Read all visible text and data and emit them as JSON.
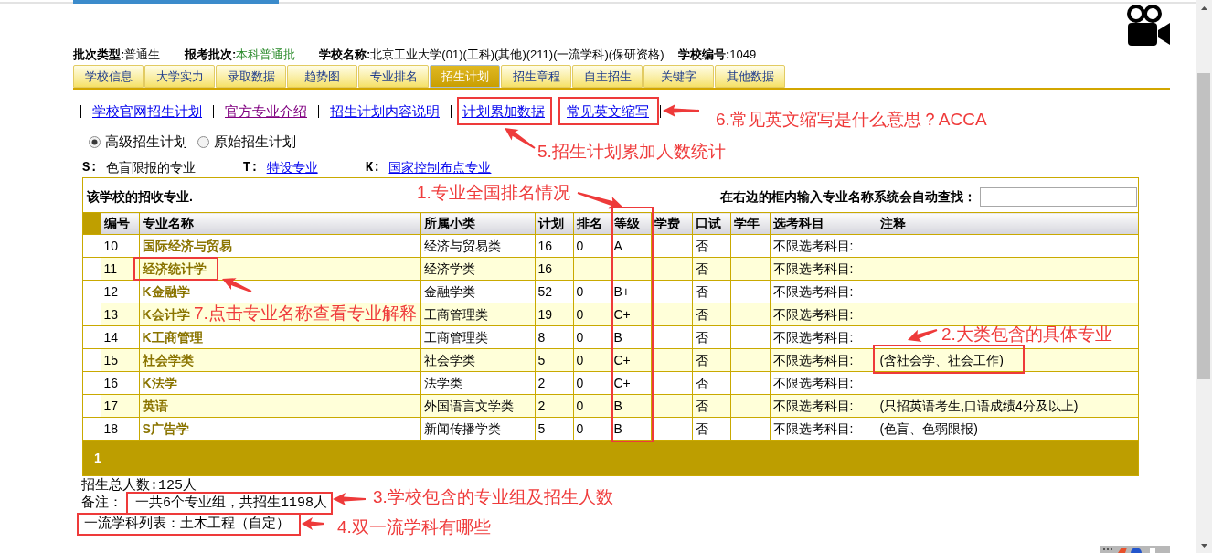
{
  "header_info": [
    {
      "label": "批次类型:",
      "value": "普通生",
      "kind": "plain"
    },
    {
      "label": "报考批次:",
      "value": "本科普通批",
      "kind": "highlight"
    },
    {
      "label": "学校名称:",
      "value": "北京工业大学(01)(工科)(其他)(211)(一流学科)(保研资格)",
      "kind": "plain"
    },
    {
      "label": "学校编号:",
      "value": "1049",
      "kind": "plain"
    }
  ],
  "tabs": [
    {
      "label": "学校信息",
      "selected": false
    },
    {
      "label": "大学实力",
      "selected": false
    },
    {
      "label": "录取数据",
      "selected": false
    },
    {
      "label": "趋势图",
      "selected": false
    },
    {
      "label": "专业排名",
      "selected": false
    },
    {
      "label": "招生计划",
      "selected": true
    },
    {
      "label": "招生章程",
      "selected": false
    },
    {
      "label": "自主招生",
      "selected": false
    },
    {
      "label": "关键字",
      "selected": false
    },
    {
      "label": "其他数据",
      "selected": false
    }
  ],
  "links": [
    {
      "label": "学校官网招生计划",
      "visited": false
    },
    {
      "label": "官方专业介绍",
      "visited": true
    },
    {
      "label": "招生计划内容说明",
      "visited": false
    },
    {
      "label": "计划累加数据",
      "visited": false
    },
    {
      "label": "常见英文缩写",
      "visited": false
    }
  ],
  "plan_options": [
    {
      "label": "高级招生计划",
      "selected": true
    },
    {
      "label": "原始招生计划",
      "selected": false
    }
  ],
  "legend": [
    {
      "key": "S:",
      "text": "色盲限报的专业",
      "kind": "plain"
    },
    {
      "key": "T:",
      "text": "特设专业",
      "kind": "link"
    },
    {
      "key": "K:",
      "text": "国家控制布点专业",
      "kind": "link"
    }
  ],
  "table": {
    "title": "该学校的招收专业.",
    "search_label": "在右边的框内输入专业名称系统会自动查找：",
    "columns": [
      "编号",
      "专业名称",
      "所属小类",
      "计划",
      "排名",
      "等级",
      "学费",
      "口试",
      "学年",
      "选考科目",
      "注释"
    ],
    "rows": [
      {
        "no": "10",
        "name": "国际经济与贸易",
        "category": "经济与贸易类",
        "plan": "16",
        "rank": "0",
        "grade": "A",
        "oral": "否",
        "subjects": "不限选考科目:"
      },
      {
        "no": "11",
        "name": "经济统计学",
        "category": "经济学类",
        "plan": "16",
        "oral": "否",
        "subjects": "不限选考科目:"
      },
      {
        "no": "12",
        "name": "K金融学",
        "category": "金融学类",
        "plan": "52",
        "rank": "0",
        "grade": "B+",
        "oral": "否",
        "subjects": "不限选考科目:"
      },
      {
        "no": "13",
        "name": "K会计学",
        "category": "工商管理类",
        "plan": "19",
        "rank": "0",
        "grade": "C+",
        "oral": "否",
        "subjects": "不限选考科目:"
      },
      {
        "no": "14",
        "name": "K工商管理",
        "category": "工商管理类",
        "plan": "8",
        "rank": "0",
        "grade": "B",
        "oral": "否",
        "subjects": "不限选考科目:"
      },
      {
        "no": "15",
        "name": "社会学类",
        "category": "社会学类",
        "plan": "5",
        "rank": "0",
        "grade": "C+",
        "oral": "否",
        "subjects": "不限选考科目:",
        "note": "(含社会学、社会工作)"
      },
      {
        "no": "16",
        "name": "K法学",
        "category": "法学类",
        "plan": "2",
        "rank": "0",
        "grade": "C+",
        "oral": "否",
        "subjects": "不限选考科目:"
      },
      {
        "no": "17",
        "name": "英语",
        "category": "外国语言文学类",
        "plan": "2",
        "rank": "0",
        "grade": "B",
        "oral": "否",
        "subjects": "不限选考科目:",
        "note": "(只招英语考生,口语成绩4分及以上)"
      },
      {
        "no": "18",
        "name": "S广告学",
        "category": "新闻传播学类",
        "plan": "5",
        "rank": "0",
        "grade": "B",
        "oral": "否",
        "subjects": "不限选考科目:",
        "note": "(色盲、色弱限报)"
      }
    ],
    "pages": [
      {
        "label": "1"
      }
    ]
  },
  "summary": {
    "total": "招生总人数:125人",
    "remark_label": "备注：",
    "remark": "一共6个专业组，共招生1198人",
    "disciplines": "一流学科列表：土木工程（自定）"
  },
  "annotations": [
    {
      "text": "6.常见英文缩写是什么意思？ACCA"
    },
    {
      "text": "5.招生计划累加人数统计"
    },
    {
      "text": "1.专业全国排名情况"
    },
    {
      "text": "7.点击专业名称查看专业解释"
    },
    {
      "text": "2.大类包含的具体专业"
    },
    {
      "text": "3.学校包含的专业组及招生人数"
    },
    {
      "text": "4.双一流学科有哪些"
    }
  ]
}
